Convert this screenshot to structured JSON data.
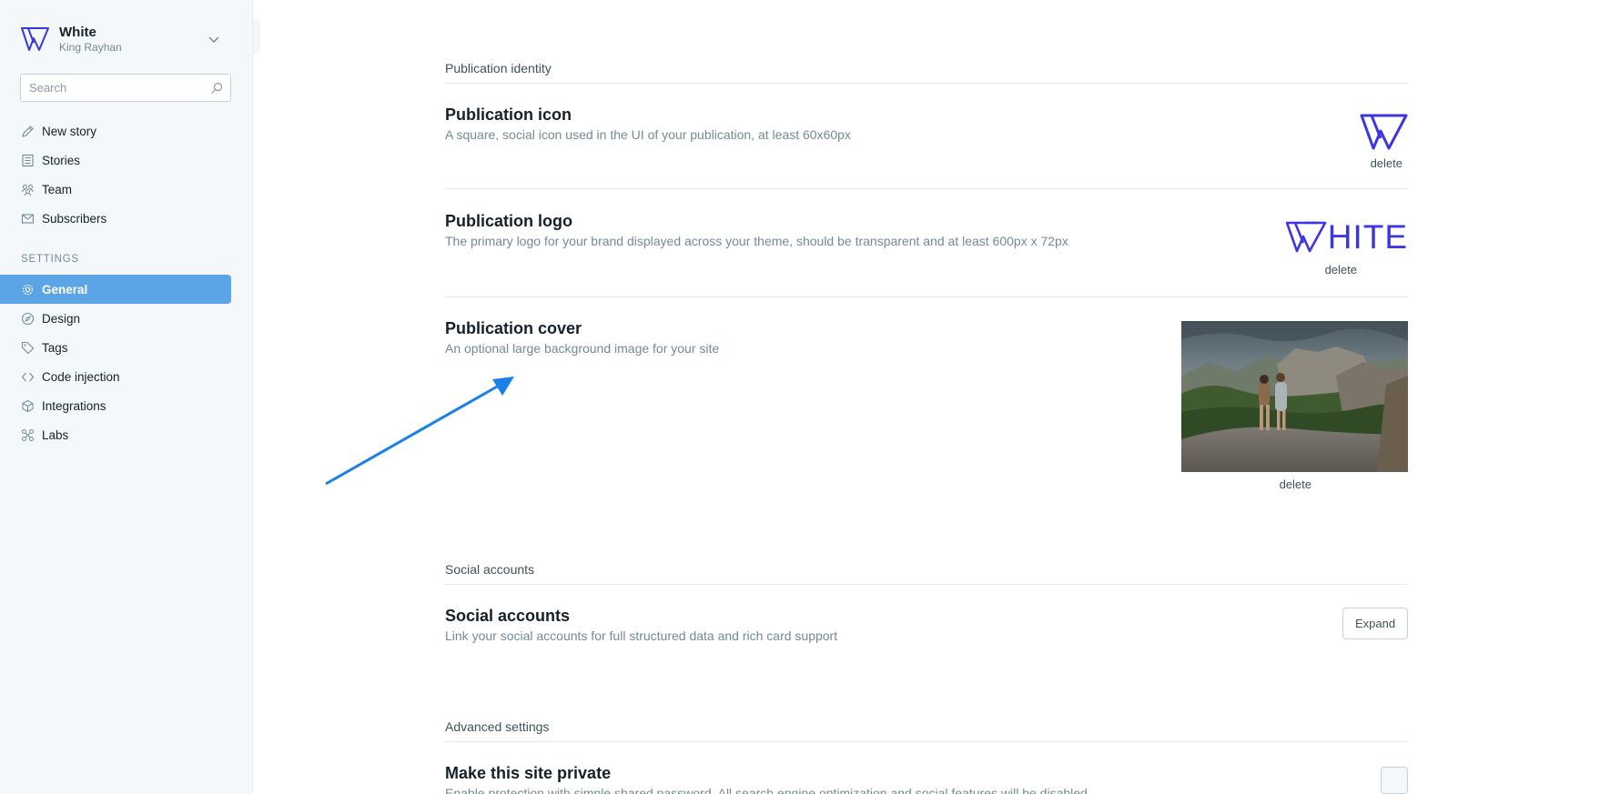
{
  "sidebar": {
    "brand_title": "White",
    "brand_user": "King Rayhan",
    "search_placeholder": "Search",
    "items": [
      {
        "label": "New story",
        "icon": "pencil-icon"
      },
      {
        "label": "Stories",
        "icon": "list-icon"
      },
      {
        "label": "Team",
        "icon": "team-icon"
      },
      {
        "label": "Subscribers",
        "icon": "mail-icon"
      }
    ],
    "settings_label": "SETTINGS",
    "settings_items": [
      {
        "label": "General",
        "icon": "gear-icon",
        "active": true
      },
      {
        "label": "Design",
        "icon": "compass-icon"
      },
      {
        "label": "Tags",
        "icon": "tag-icon"
      },
      {
        "label": "Code injection",
        "icon": "code-icon"
      },
      {
        "label": "Integrations",
        "icon": "box-icon"
      },
      {
        "label": "Labs",
        "icon": "labs-icon"
      }
    ]
  },
  "main": {
    "identity": {
      "group_title": "Publication identity",
      "icon_title": "Publication icon",
      "icon_desc": "A square, social icon used in the UI of your publication, at least 60x60px",
      "icon_delete": "delete",
      "logo_title": "Publication logo",
      "logo_desc": "The primary logo for your brand displayed across your theme, should be transparent and at least 600px x 72px",
      "logo_text": "HITE",
      "logo_delete": "delete",
      "cover_title": "Publication cover",
      "cover_desc": "An optional large background image for your site",
      "cover_delete": "delete"
    },
    "social": {
      "group_title": "Social accounts",
      "title": "Social accounts",
      "desc": "Link your social accounts for full structured data and rich card support",
      "expand": "Expand"
    },
    "advanced": {
      "group_title": "Advanced settings",
      "title": "Make this site private",
      "desc": "Enable protection with simple shared password. All search engine optimization and social features will be disabled"
    }
  },
  "colors": {
    "accent": "#5ba4e5",
    "brand": "#3b36e0",
    "annotation_arrow": "#1a7fe8"
  }
}
